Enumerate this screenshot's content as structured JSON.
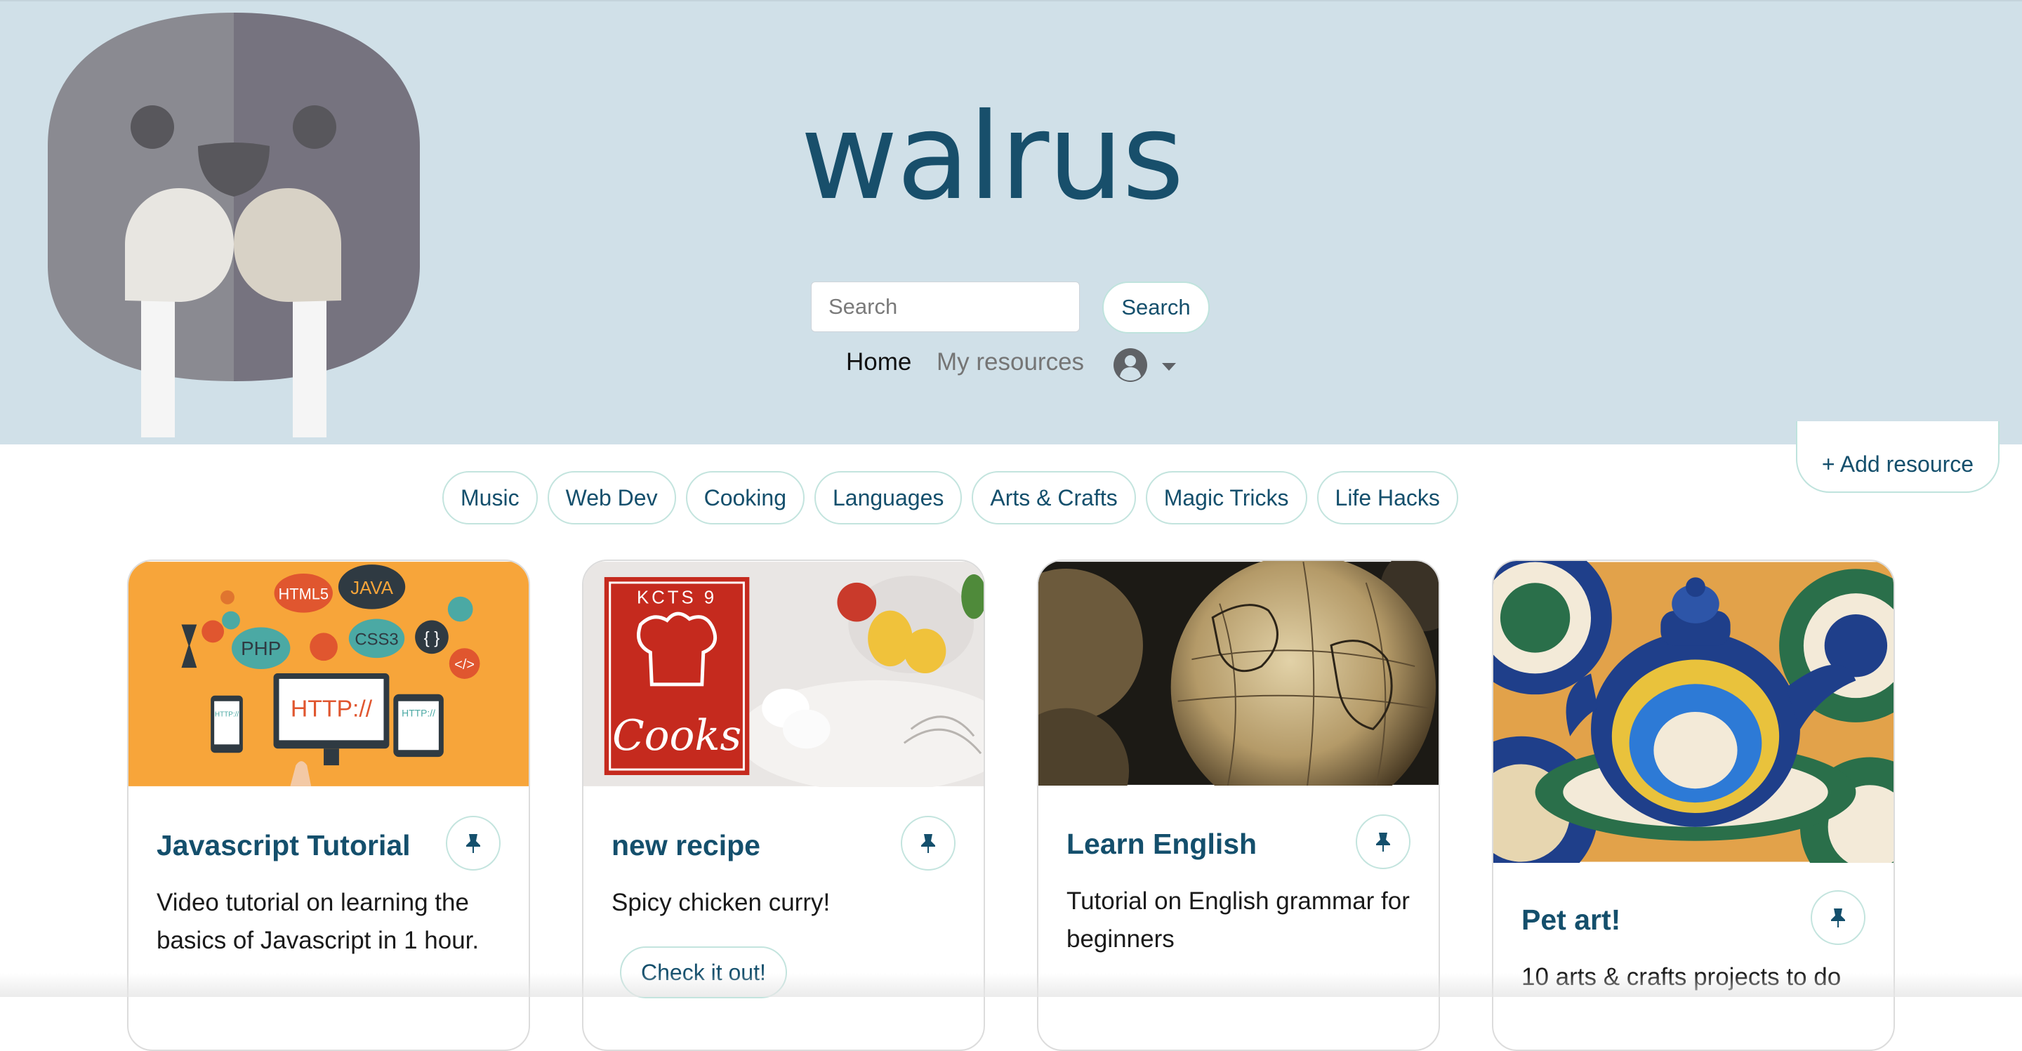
{
  "brand": {
    "wordmark": "walrus"
  },
  "search": {
    "placeholder": "Search",
    "value": "",
    "button_label": "Search"
  },
  "nav": {
    "home": "Home",
    "my_resources": "My resources"
  },
  "add_resource_label": "+ Add resource",
  "categories": [
    "Music",
    "Web Dev",
    "Cooking",
    "Languages",
    "Arts & Crafts",
    "Magic Tricks",
    "Life Hacks"
  ],
  "cards": [
    {
      "title": "Javascript Tutorial",
      "description": "Video tutorial on learning the basics of Javascript in 1 hour.",
      "image_labels": [
        "HTML5",
        "JAVA",
        "PHP",
        "CSS3",
        "{ }",
        "HTTP://",
        "HTTP://",
        "HTTP://",
        "</>"
      ]
    },
    {
      "title": "new recipe",
      "description": "Spicy chicken curry!",
      "button_label": "Check it out!",
      "image_labels": [
        "KCTS 9",
        "Cooks"
      ]
    },
    {
      "title": "Learn English",
      "description": "Tutorial on English grammar for beginners"
    },
    {
      "title": "Pet art!",
      "description": "10 arts & crafts projects to do"
    }
  ],
  "colors": {
    "header_bg": "#d0e0e8",
    "accent": "#144f6c",
    "pill_border": "#c3e4de"
  },
  "icons": [
    "walrus-logo",
    "user-avatar-icon",
    "caret-down-icon",
    "pin-icon"
  ]
}
